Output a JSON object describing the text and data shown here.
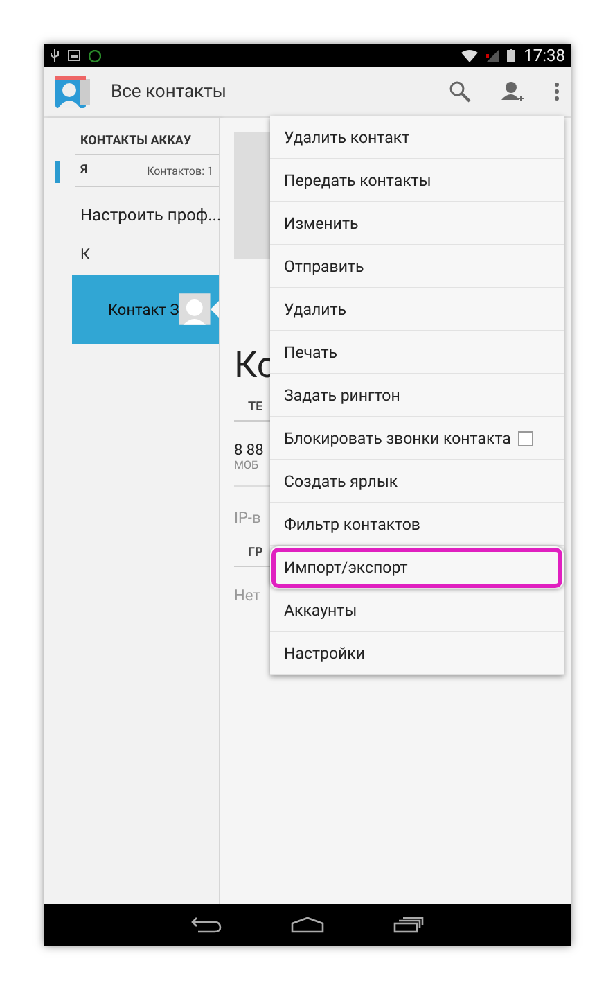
{
  "status_bar": {
    "time": "17:38"
  },
  "action_bar": {
    "title": "Все контакты"
  },
  "contact_list": {
    "header": "КОНТАКТЫ АККАУ",
    "me_label": "Я",
    "me_count": "Контактов: 1",
    "setup_profile": "Настроить проф...",
    "section": "К",
    "items": [
      {
        "name": "Контакт З",
        "selected": true
      }
    ]
  },
  "detail": {
    "name": "Ко",
    "phone_header": "ТЕ",
    "phone": "8 88",
    "phone_type": "МОБ",
    "ip_label": "IP-в",
    "groups_header": "ГР",
    "groups_value": "Нет"
  },
  "menu": [
    {
      "label": "Удалить контакт",
      "kind": "plain",
      "highlighted": false
    },
    {
      "label": "Передать контакты",
      "kind": "plain",
      "highlighted": false
    },
    {
      "label": "Изменить",
      "kind": "plain",
      "highlighted": false
    },
    {
      "label": "Отправить",
      "kind": "plain",
      "highlighted": false
    },
    {
      "label": "Удалить",
      "kind": "plain",
      "highlighted": false
    },
    {
      "label": "Печать",
      "kind": "plain",
      "highlighted": false
    },
    {
      "label": "Задать рингтон",
      "kind": "plain",
      "highlighted": false
    },
    {
      "label": "Блокировать звонки контакта",
      "kind": "checkbox",
      "checked": false,
      "highlighted": false
    },
    {
      "label": "Создать ярлык",
      "kind": "plain",
      "highlighted": false
    },
    {
      "label": "Фильтр контактов",
      "kind": "plain",
      "highlighted": false
    },
    {
      "label": "Импорт/экспорт",
      "kind": "plain",
      "highlighted": true
    },
    {
      "label": "Аккаунты",
      "kind": "plain",
      "highlighted": false
    },
    {
      "label": "Настройки",
      "kind": "plain",
      "highlighted": false
    }
  ]
}
